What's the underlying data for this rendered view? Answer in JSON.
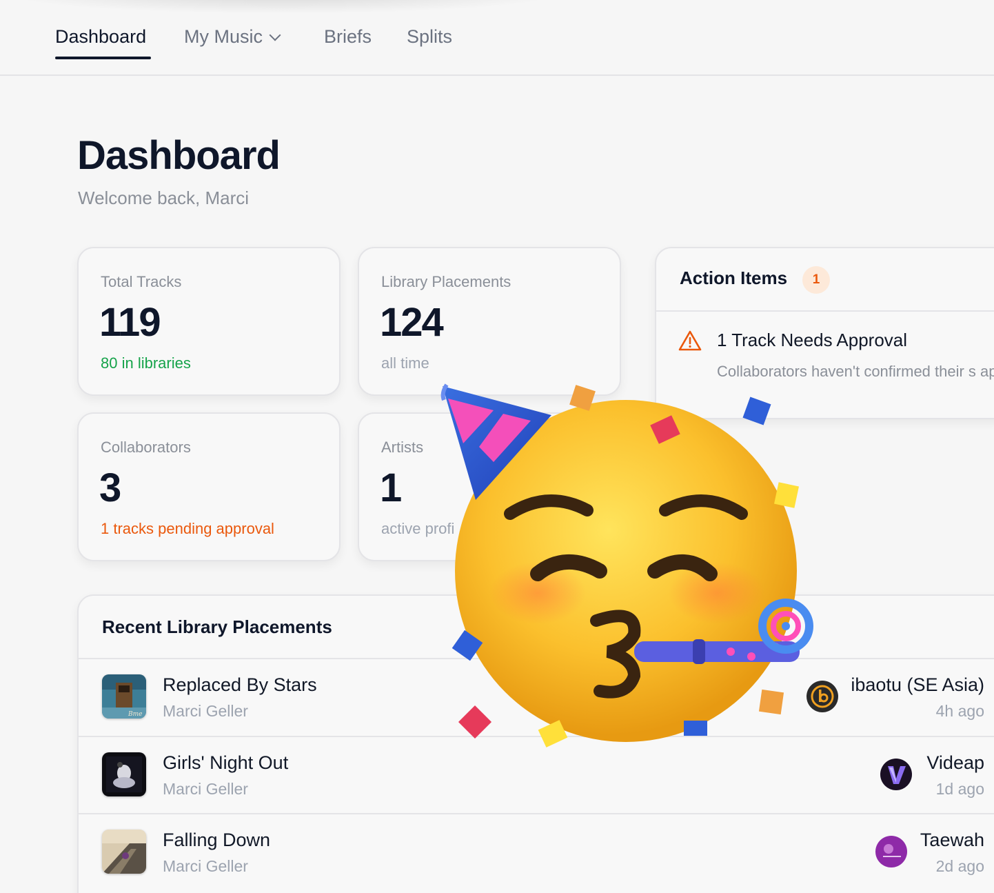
{
  "nav": {
    "tabs": [
      {
        "label": "Dashboard",
        "active": true
      },
      {
        "label": "My Music",
        "has_dropdown": true
      },
      {
        "label": "Briefs"
      },
      {
        "label": "Splits"
      }
    ]
  },
  "header": {
    "title": "Dashboard",
    "subtitle": "Welcome back, Marci"
  },
  "stats": {
    "total_tracks": {
      "label": "Total Tracks",
      "value": "119",
      "note": "80 in libraries"
    },
    "library_placements": {
      "label": "Library Placements",
      "value": "124",
      "note": "all time"
    },
    "collaborators": {
      "label": "Collaborators",
      "value": "3",
      "note": "1 tracks pending approval"
    },
    "artists": {
      "label": "Artists",
      "value": "1",
      "note": "active profi"
    }
  },
  "action_items": {
    "title": "Action Items",
    "count": "1",
    "items": [
      {
        "icon": "warning-icon",
        "title": "1 Track Needs Approval",
        "description": "Collaborators haven't confirmed their s approve."
      }
    ]
  },
  "recent_placements": {
    "title": "Recent Library Placements",
    "rows": [
      {
        "track": "Replaced By Stars",
        "artist": "Marci Geller",
        "library": "ibaotu (SE Asia)",
        "time": "4h ago"
      },
      {
        "track": "Girls' Night Out",
        "artist": "Marci Geller",
        "library": "Videap",
        "time": "1d ago"
      },
      {
        "track": "Falling Down",
        "artist": "Marci Geller",
        "library": "Taewah",
        "time": "2d ago"
      }
    ]
  },
  "overlay": {
    "icon": "party-face-emoji-icon"
  },
  "colors": {
    "accent_text": "#0f172a",
    "positive": "#16a34a",
    "warning": "#ea580c",
    "muted": "#8a8f98",
    "background": "#f6f6f6"
  }
}
